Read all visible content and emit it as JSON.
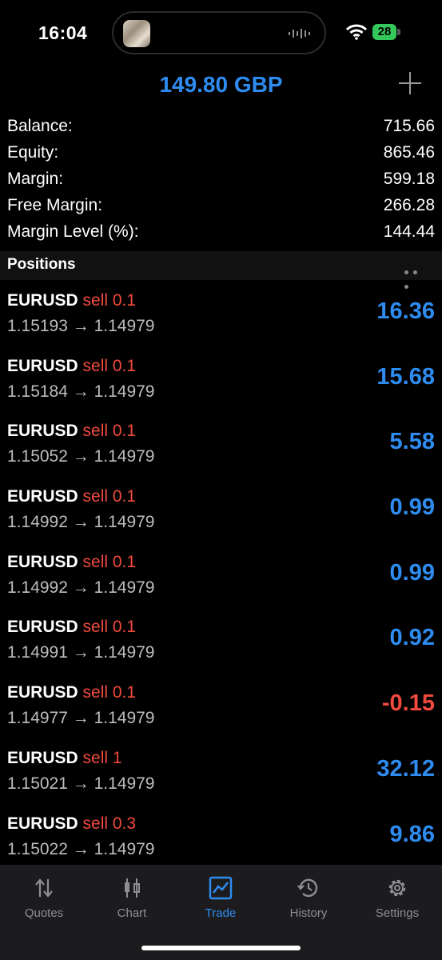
{
  "status_bar": {
    "time": "16:04",
    "battery": "28"
  },
  "header": {
    "title": "149.80 GBP"
  },
  "summary": [
    {
      "label": "Balance:",
      "value": "715.66"
    },
    {
      "label": "Equity:",
      "value": "865.46"
    },
    {
      "label": "Margin:",
      "value": "599.18"
    },
    {
      "label": "Free Margin:",
      "value": "266.28"
    },
    {
      "label": "Margin Level (%):",
      "value": "144.44"
    }
  ],
  "positions": {
    "title": "Positions",
    "items": [
      {
        "symbol": "EURUSD",
        "side": "sell 0.1",
        "prices": "1.15193 → 1.14979",
        "profit": "16.36"
      },
      {
        "symbol": "EURUSD",
        "side": "sell 0.1",
        "prices": "1.15184 → 1.14979",
        "profit": "15.68"
      },
      {
        "symbol": "EURUSD",
        "side": "sell 0.1",
        "prices": "1.15052 → 1.14979",
        "profit": "5.58"
      },
      {
        "symbol": "EURUSD",
        "side": "sell 0.1",
        "prices": "1.14992 → 1.14979",
        "profit": "0.99"
      },
      {
        "symbol": "EURUSD",
        "side": "sell 0.1",
        "prices": "1.14992 → 1.14979",
        "profit": "0.99"
      },
      {
        "symbol": "EURUSD",
        "side": "sell 0.1",
        "prices": "1.14991 → 1.14979",
        "profit": "0.92"
      },
      {
        "symbol": "EURUSD",
        "side": "sell 0.1",
        "prices": "1.14977 → 1.14979",
        "profit": "-0.15"
      },
      {
        "symbol": "EURUSD",
        "side": "sell 1",
        "prices": "1.15021 → 1.14979",
        "profit": "32.12"
      },
      {
        "symbol": "EURUSD",
        "side": "sell 0.3",
        "prices": "1.15022 → 1.14979",
        "profit": "9.86"
      }
    ]
  },
  "tabs": [
    {
      "label": "Quotes",
      "icon": "quotes-icon"
    },
    {
      "label": "Chart",
      "icon": "chart-icon"
    },
    {
      "label": "Trade",
      "icon": "trade-icon",
      "active": true
    },
    {
      "label": "History",
      "icon": "history-icon"
    },
    {
      "label": "Settings",
      "icon": "settings-icon"
    }
  ],
  "colors": {
    "accent": "#2e8cf0",
    "negative": "#f04a3e",
    "tab_bar": "#1c1c1e"
  }
}
